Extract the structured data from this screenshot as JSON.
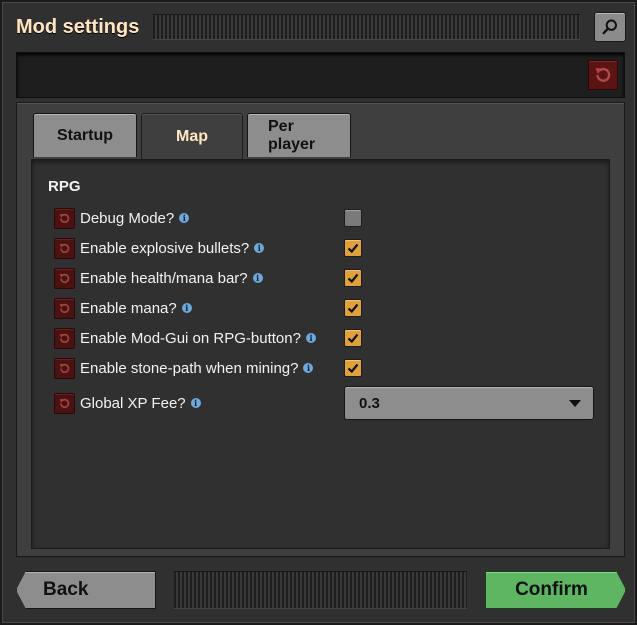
{
  "window": {
    "title": "Mod settings"
  },
  "icons": {
    "search": "search-icon",
    "reset": "reset-icon",
    "info": "info-icon",
    "check": "check-icon",
    "dropdown": "chevron-down-icon"
  },
  "colors": {
    "title": "#ffe6c0",
    "reset_button": "#5a1413",
    "checkbox_checked": "#e0a03a",
    "confirm": "#5eb663"
  },
  "tabs": [
    {
      "label": "Startup",
      "active": false
    },
    {
      "label": "Map",
      "active": true
    },
    {
      "label": "Per player",
      "active": false
    }
  ],
  "section": {
    "title": "RPG"
  },
  "settings": [
    {
      "label": "Debug Mode?",
      "checked": false
    },
    {
      "label": "Enable explosive bullets?",
      "checked": true
    },
    {
      "label": "Enable health/mana bar?",
      "checked": true
    },
    {
      "label": "Enable mana?",
      "checked": true
    },
    {
      "label": "Enable Mod-Gui on RPG-button?",
      "checked": true
    },
    {
      "label": "Enable stone-path when mining?",
      "checked": true
    },
    {
      "label": "Global XP Fee?",
      "value": "0.3"
    }
  ],
  "info_glyph": "i",
  "buttons": {
    "back": "Back",
    "confirm": "Confirm"
  }
}
